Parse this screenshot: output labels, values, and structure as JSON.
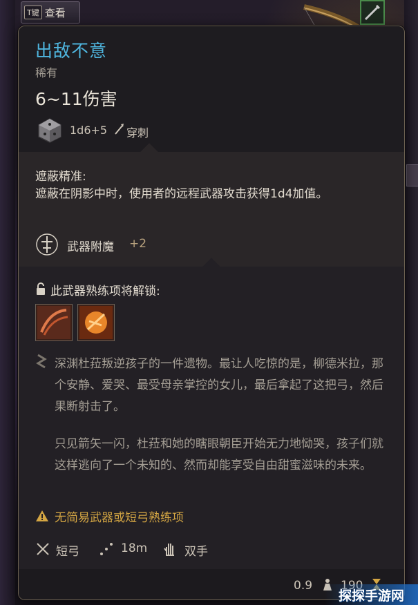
{
  "top_button": {
    "key": "T键",
    "label": "查看"
  },
  "item": {
    "name": "出敌不意",
    "rarity": "稀有",
    "damage": "6~11伤害",
    "dice": "1d6+5",
    "damage_type": "穿刺",
    "name_color": "#4fb6df"
  },
  "ability": {
    "title": "遮蔽精准:",
    "description": "遮蔽在阴影中时，使用者的远程武器攻击获得1d4加值。"
  },
  "enchantment": {
    "label": "武器附魔",
    "value": "+2"
  },
  "proficiency": {
    "unlock_text": "此武器熟练项将解锁:"
  },
  "lore": {
    "paragraph_1": "深渊杜菈叛逆孩子的一件遗物。最让人吃惊的是，柳德米拉，那个安静、爱哭、最受母亲掌控的女儿，最后拿起了这把弓，然后果断射击了。",
    "paragraph_2": "只见箭矢一闪，杜菈和她的瞎眼朝臣开始无力地恸哭，孩子们就这样逃向了一个未知的、然而却能享受自由甜蜜滋味的未来。"
  },
  "warning": {
    "text": "无简易武器或短弓熟练项",
    "color": "#d4a643"
  },
  "properties": {
    "weapon_type": "短弓",
    "range": "18m",
    "handedness": "双手"
  },
  "footer": {
    "weight": "0.9",
    "price": "190"
  },
  "watermark": "探探手游网",
  "icons": [
    "dice-icon",
    "pierce-icon",
    "enchantment-icon",
    "lock-icon",
    "quote-icon",
    "warning-icon",
    "crossed-swords-icon",
    "range-icon",
    "hand-icon",
    "weight-icon",
    "coin-icon"
  ]
}
